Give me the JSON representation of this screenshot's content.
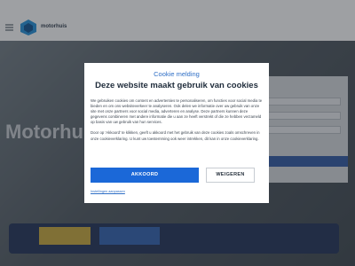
{
  "topbar": {
    "links": [
      "",
      "",
      "",
      "",
      ""
    ]
  },
  "header": {
    "logo_text": "motorhuis",
    "right_items": [
      "",
      ""
    ]
  },
  "hero": {
    "title": "Motorhu",
    "subtitle": "",
    "bottom_text": ""
  },
  "side_panel": {
    "title": "",
    "button": ""
  },
  "bottom_bar": {
    "btn1": "",
    "btn2": ""
  },
  "modal": {
    "kicker": "Cookie melding",
    "title": "Deze website maakt gebruik van cookies",
    "body_p1": "We gebruiken cookies om content en advertenties te personaliseren, om functies voor social media te bieden en om ons websiteverkeer te analyseren. Ook delen we informatie over uw gebruik van onze site met onze partners voor social media, adverteren en analyse. Deze partners kunnen deze gegevens combineren met andere informatie die u aan ze heeft verstrekt of die ze hebben verzameld op basis van uw gebruik van hun services.",
    "body_p2": "Door op 'Akkoord' te klikken, geeft u akkoord met het gebruik van deze cookies zoals omschreven in onze cookieverklaring. U kunt uw toestemming ook weer intrekken, dit kan in onze cookieverklaring.",
    "accept_label": "AKKOORD",
    "decline_label": "WEIGEREN",
    "settings_link": "Instellingen aanpassen"
  },
  "colors": {
    "accent": "#1b68d8",
    "kicker": "#2f6fc6",
    "title": "#1e2b3a"
  }
}
